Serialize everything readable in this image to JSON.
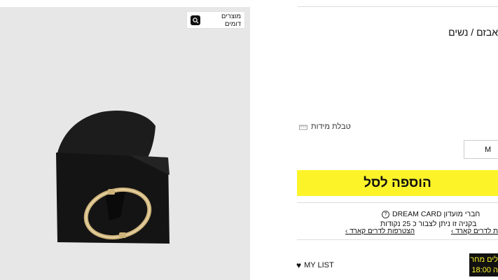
{
  "photo": {
    "similar_products_label": "מוצרים דומים"
  },
  "product": {
    "title": "אבזם / נשים",
    "size_guide_label": "טבלת מידות",
    "selected_size": "M",
    "add_to_cart_label": "הוספה לסל"
  },
  "dream_card": {
    "members_label": "חברי מועדון DREAM CARD",
    "points_text": "בקניה זו ניתן לצבור כ 25 נקודות",
    "join_link": "הצטרפות לדרים קארד ›",
    "card_link": "ת לדרים קארד ›"
  },
  "actions": {
    "my_list_label": "MY LIST"
  },
  "promo": {
    "line1": "לים מחר",
    "line2": "ה 18:00"
  }
}
